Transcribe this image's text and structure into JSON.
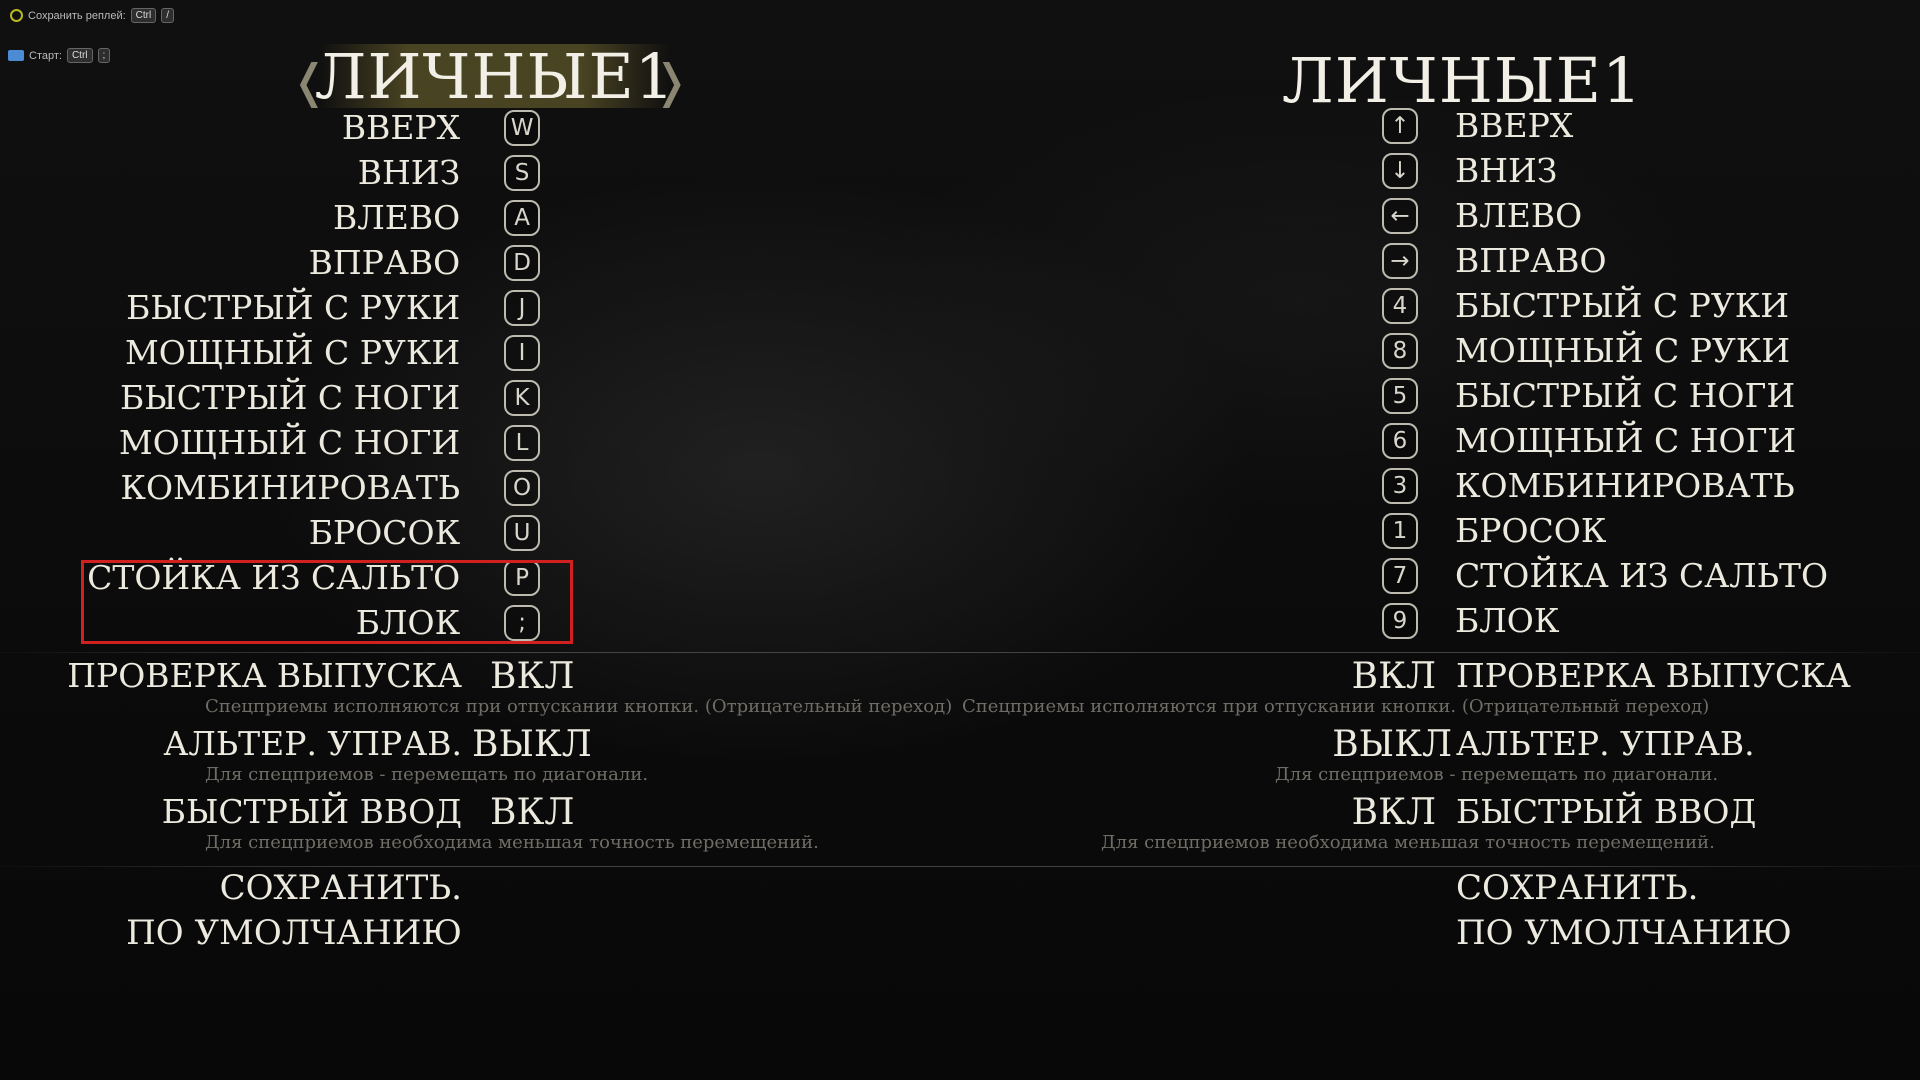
{
  "overlay": {
    "save_replay_label": "Сохранить реплей:",
    "save_replay_key1": "Ctrl",
    "save_replay_key2": "/",
    "start_label": "Старт:",
    "start_key1": "Ctrl",
    "start_key2": ";"
  },
  "left_panel": {
    "title": "ЛИЧНЫЕ1",
    "bindings": [
      {
        "label": "ВВЕРХ",
        "key": "W"
      },
      {
        "label": "ВНИЗ",
        "key": "S"
      },
      {
        "label": "ВЛЕВО",
        "key": "A"
      },
      {
        "label": "ВПРАВО",
        "key": "D"
      },
      {
        "label": "БЫСТРЫЙ С РУКИ",
        "key": "J"
      },
      {
        "label": "МОЩНЫЙ С РУКИ",
        "key": "I"
      },
      {
        "label": "БЫСТРЫЙ С НОГИ",
        "key": "K"
      },
      {
        "label": "МОЩНЫЙ С НОГИ",
        "key": "L"
      },
      {
        "label": "КОМБИНИРОВАТЬ",
        "key": "O"
      },
      {
        "label": "БРОСОК",
        "key": "U"
      },
      {
        "label": "СТОЙКА ИЗ САЛЬТО",
        "key": "P"
      },
      {
        "label": "БЛОК",
        "key": ";"
      }
    ],
    "options": [
      {
        "label": "ПРОВЕРКА ВЫПУСКА",
        "value": "ВКЛ",
        "desc": "Спецприемы исполняются при отпускании кнопки. (Отрицательный переход)"
      },
      {
        "label": "АЛЬТЕР. УПРАВ.",
        "value": "ВЫКЛ",
        "desc": "Для спецприемов - перемещать по диагонали."
      },
      {
        "label": "БЫСТРЫЙ ВВОД",
        "value": "ВКЛ",
        "desc": "Для спецприемов необходима меньшая точность перемещений."
      }
    ],
    "actions": {
      "save": "СОХРАНИТЬ.",
      "defaults": "ПО УМОЛЧАНИЮ"
    }
  },
  "right_panel": {
    "title": "ЛИЧНЫЕ1",
    "bindings": [
      {
        "label": "ВВЕРХ",
        "key": "↑"
      },
      {
        "label": "ВНИЗ",
        "key": "↓"
      },
      {
        "label": "ВЛЕВО",
        "key": "←"
      },
      {
        "label": "ВПРАВО",
        "key": "→"
      },
      {
        "label": "БЫСТРЫЙ С РУКИ",
        "key": "4"
      },
      {
        "label": "МОЩНЫЙ С РУКИ",
        "key": "8"
      },
      {
        "label": "БЫСТРЫЙ С НОГИ",
        "key": "5"
      },
      {
        "label": "МОЩНЫЙ С НОГИ",
        "key": "6"
      },
      {
        "label": "КОМБИНИРОВАТЬ",
        "key": "3"
      },
      {
        "label": "БРОСОК",
        "key": "1"
      },
      {
        "label": "СТОЙКА ИЗ САЛЬТО",
        "key": "7"
      },
      {
        "label": "БЛОК",
        "key": "9"
      }
    ],
    "options": [
      {
        "label": "ПРОВЕРКА ВЫПУСКА",
        "value": "ВКЛ",
        "desc": "Спецприемы исполняются при отпускании кнопки. (Отрицательный переход)"
      },
      {
        "label": "АЛЬТЕР. УПРАВ.",
        "value": "ВЫКЛ",
        "desc": "Для спецприемов - перемещать по диагонали."
      },
      {
        "label": "БЫСТРЫЙ ВВОД",
        "value": "ВКЛ",
        "desc": "Для спецприемов необходима меньшая точность перемещений."
      }
    ],
    "actions": {
      "save": "СОХРАНИТЬ.",
      "defaults": "ПО УМОЛЧАНИЮ"
    }
  },
  "colors": {
    "selection_border": "#d02020",
    "title_highlight": "#786e32"
  }
}
